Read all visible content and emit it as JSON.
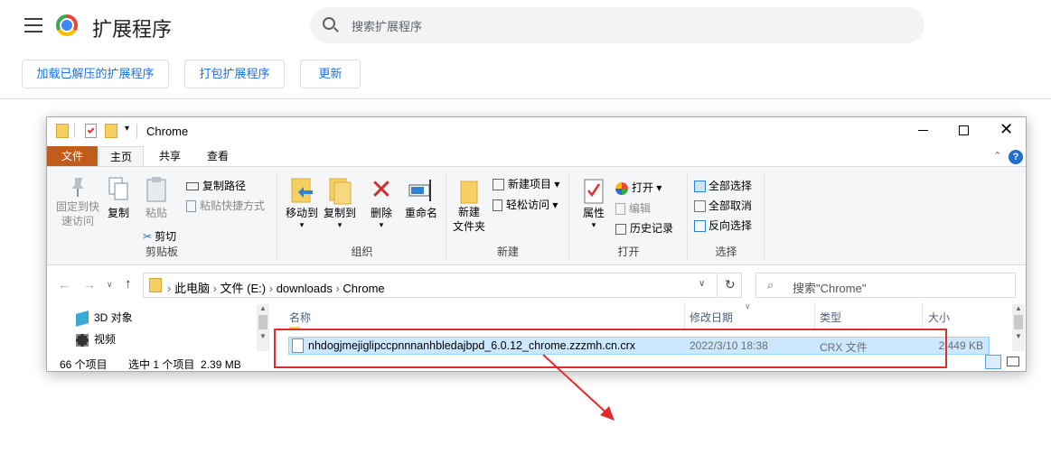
{
  "chrome_page": {
    "title": "扩展程序",
    "search_placeholder": "搜索扩展程序",
    "buttons": [
      "加载已解压的扩展程序",
      "打包扩展程序",
      "更新"
    ]
  },
  "explorer": {
    "window_title": "Chrome",
    "tabs": [
      "文件",
      "主页",
      "共享",
      "查看"
    ],
    "ribbon": {
      "clipboard": {
        "group": "剪贴板",
        "pin": "固定到快速访问",
        "copy": "复制",
        "paste": "粘贴",
        "copy_path": "复制路径",
        "paste_shortcut": "粘贴快捷方式",
        "cut": "剪切"
      },
      "organize": {
        "group": "组织",
        "move_to": "移动到",
        "copy_to": "复制到",
        "delete": "删除",
        "rename": "重命名"
      },
      "new": {
        "group": "新建",
        "new_folder": "新建\n文件夹",
        "new_item": "新建项目",
        "easy_access": "轻松访问"
      },
      "open": {
        "group": "打开",
        "properties": "属性",
        "open": "打开",
        "edit": "编辑",
        "history": "历史记录"
      },
      "select": {
        "group": "选择",
        "select_all": "全部选择",
        "select_none": "全部取消",
        "invert": "反向选择"
      }
    },
    "breadcrumb": [
      "此电脑",
      "文件 (E:)",
      "downloads",
      "Chrome"
    ],
    "search_placeholder": "搜索\"Chrome\"",
    "nav_items": [
      {
        "label": "3D 对象",
        "icon": "3d-objects-icon"
      },
      {
        "label": "视频",
        "icon": "video-icon"
      }
    ],
    "columns": [
      "名称",
      "修改日期",
      "类型",
      "大小"
    ],
    "files": [
      {
        "name": "nhdogjmejiglipccpnnnanhbledajbpd_6.0.12_chrome.zzzmh.cn.crx",
        "modified": "2022/3/10 18:38",
        "type": "CRX 文件",
        "size": "2,449 KB"
      }
    ],
    "status": {
      "count": "66 个项目",
      "selected": "选中 1 个项目  2.39 MB"
    }
  },
  "colors": {
    "accent_blue": "#1a73e8",
    "file_tab": "#c05d1a",
    "selection": "#cce8ff",
    "annotation_red": "#e32b2b"
  }
}
